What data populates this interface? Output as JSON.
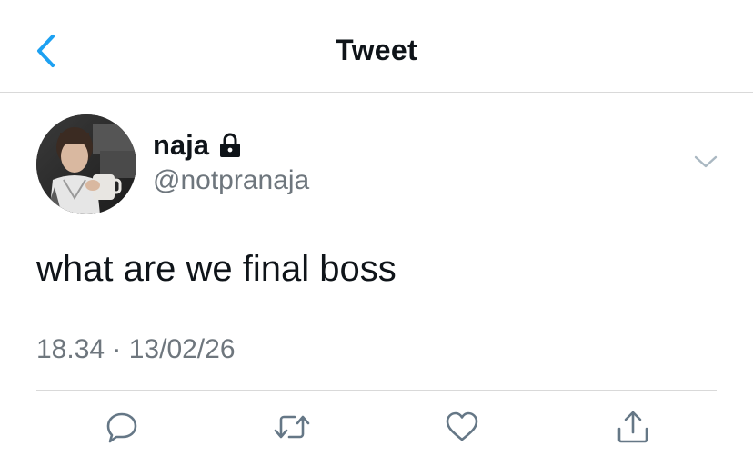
{
  "header": {
    "title": "Tweet",
    "back_icon": "chevron-left-icon"
  },
  "tweet": {
    "author": {
      "display_name": "naja",
      "handle": "@notpranaja",
      "protected_icon": "lock-icon"
    },
    "text": "what are we final boss",
    "timestamp": "18.34 · 13/02/26"
  },
  "actions": [
    "reply-icon",
    "retweet-icon",
    "like-icon",
    "share-icon"
  ],
  "colors": {
    "accent": "#1da1f2",
    "icon_gray": "#657786",
    "secondary_text": "#6e767d",
    "divider": "#d9d9d9"
  }
}
